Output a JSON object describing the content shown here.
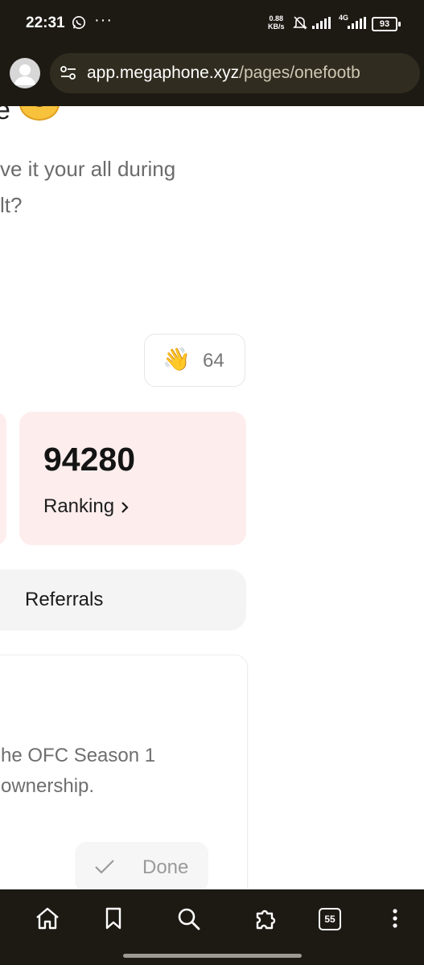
{
  "status_bar": {
    "time": "22:31",
    "speed_value": "0.88",
    "speed_unit": "KB/s",
    "network": "4G",
    "battery": "93",
    "overflow": "···"
  },
  "address_bar": {
    "url_domain": "app.megaphone.xyz",
    "url_path": "/pages/onefootb"
  },
  "content": {
    "heading_fragment": "e",
    "question_line1": "ve it your all during",
    "question_line2": "lt?",
    "clap_count": "64",
    "stat_value": "94280",
    "stat_label": "Ranking",
    "referrals_label": "Referrals",
    "task_line1": "he OFC Season 1",
    "task_line2": "ownership.",
    "done_label": "Done"
  },
  "toolbar": {
    "tab_count": "55"
  },
  "colors": {
    "chrome_bg": "#1d1a14",
    "url_pill_bg": "#312c20",
    "stat_card_bg": "#fdeeed",
    "referrals_bg": "#f4f4f4"
  },
  "icons": [
    "whatsapp-icon",
    "bell-off-icon",
    "signal-icon",
    "battery-icon",
    "avatar-icon",
    "tune-icon",
    "clap-icon",
    "chevron-right-icon",
    "check-icon",
    "home-icon",
    "bookmark-icon",
    "search-icon",
    "extension-icon",
    "tabs-icon",
    "more-icon"
  ]
}
